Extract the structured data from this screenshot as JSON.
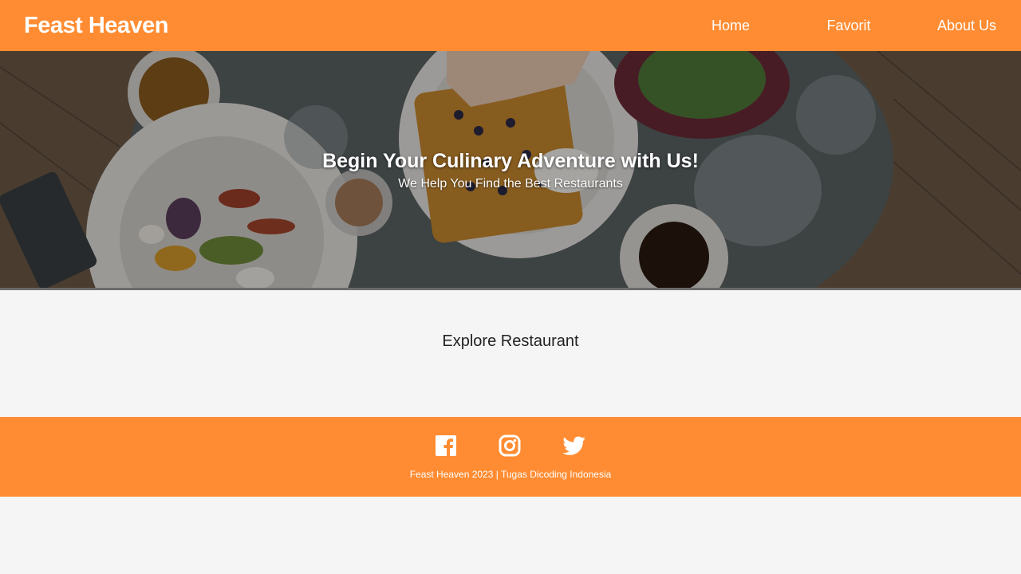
{
  "header": {
    "brand": "Feast Heaven",
    "nav": [
      {
        "label": "Home"
      },
      {
        "label": "Favorit"
      },
      {
        "label": "About Us"
      }
    ],
    "background_color": "#ff8c32"
  },
  "hero": {
    "title": "Begin Your Culinary Adventure with Us!",
    "subtitle": "We Help You Find the Best Restaurants"
  },
  "main": {
    "heading": "Explore Restaurant"
  },
  "footer": {
    "social_icons": [
      "facebook-icon",
      "instagram-icon",
      "twitter-icon"
    ],
    "copyright": "Feast Heaven 2023 | Tugas Dicoding Indonesia",
    "background_color": "#ff8c32"
  },
  "colors": {
    "accent": "#ff8c32",
    "page_background": "#f5f5f5"
  }
}
